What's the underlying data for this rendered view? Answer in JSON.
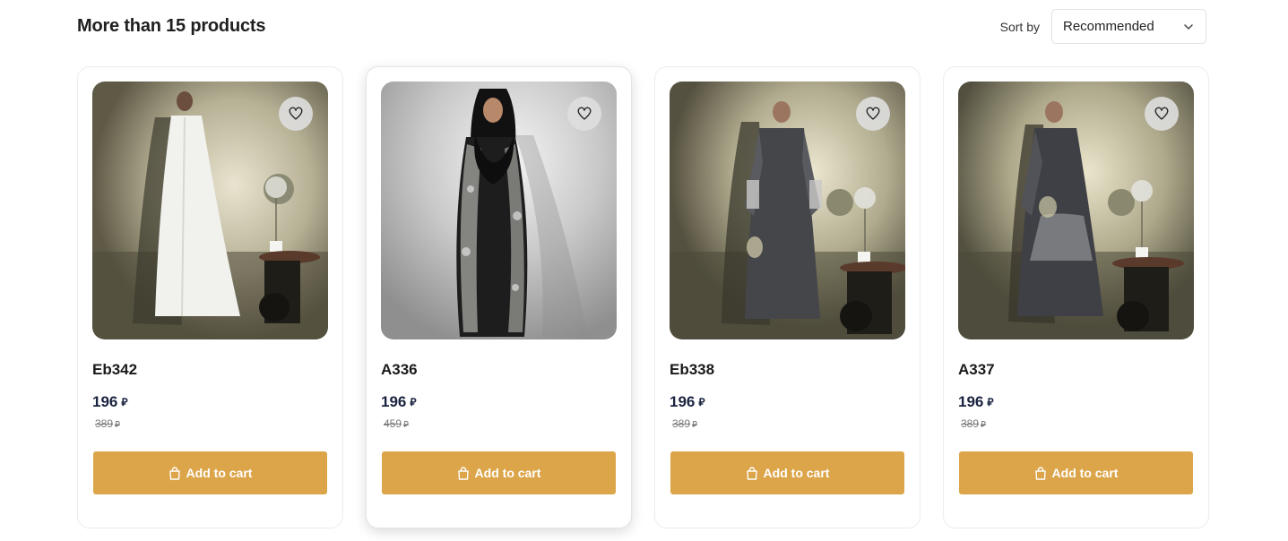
{
  "header": {
    "title": "More than 15 products",
    "sort_label": "Sort by",
    "sort_value": "Recommended"
  },
  "currency_symbol": "⃁",
  "products": [
    {
      "name": "Eb342",
      "price": "196",
      "old_price": "389",
      "dress": "white",
      "add_label": "Add to cart"
    },
    {
      "name": "A336",
      "price": "196",
      "old_price": "459",
      "dress": "black-floral",
      "add_label": "Add to cart"
    },
    {
      "name": "Eb338",
      "price": "196",
      "old_price": "389",
      "dress": "charcoal",
      "add_label": "Add to cart"
    },
    {
      "name": "A337",
      "price": "196",
      "old_price": "389",
      "dress": "charcoal-embroidered",
      "add_label": "Add to cart"
    }
  ],
  "colors": {
    "accent": "#dca54a",
    "price": "#1a2440"
  }
}
